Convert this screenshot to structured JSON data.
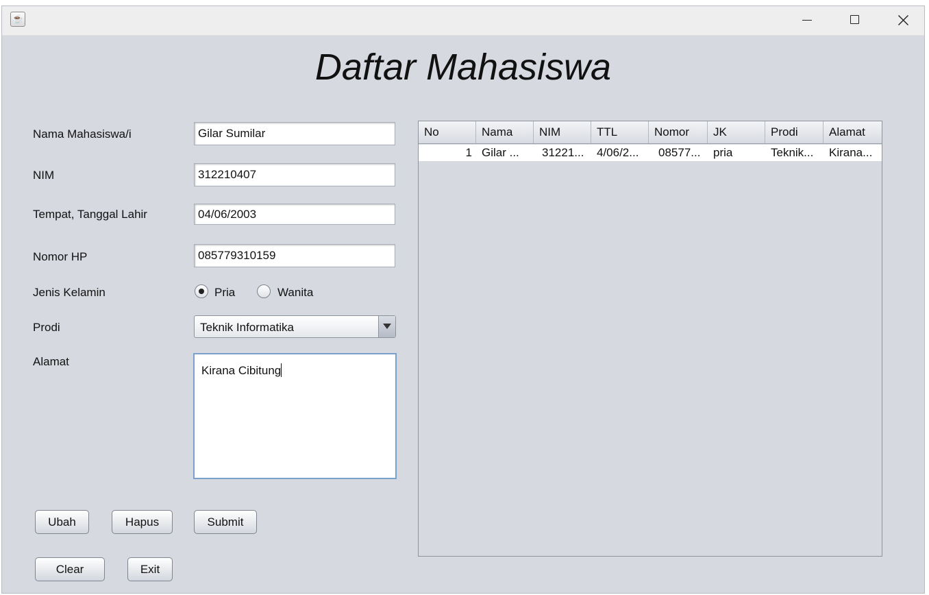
{
  "window": {
    "title": ""
  },
  "form": {
    "heading": "Daftar Mahasiswa",
    "labels": {
      "nama": "Nama Mahasiswa/i",
      "nim": "NIM",
      "ttl": "Tempat, Tanggal Lahir",
      "nomor": "Nomor HP",
      "jk": "Jenis Kelamin",
      "prodi": "Prodi",
      "alamat": "Alamat"
    },
    "values": {
      "nama": "Gilar Sumilar",
      "nim": "312210407",
      "ttl": "04/06/2003",
      "nomor": "085779310159",
      "prodi": "Teknik Informatika",
      "alamat": "Kirana Cibitung"
    },
    "gender_options": [
      "Pria",
      "Wanita"
    ],
    "gender_selected": "Pria",
    "buttons": {
      "ubah": "Ubah",
      "hapus": "Hapus",
      "submit": "Submit",
      "clear": "Clear",
      "exit": "Exit"
    }
  },
  "table": {
    "columns": [
      "No",
      "Nama",
      "NIM",
      "TTL",
      "Nomor",
      "JK",
      "Prodi",
      "Alamat"
    ],
    "rows": [
      [
        "1",
        "Gilar ...",
        "31221...",
        "4/06/2...",
        "08577...",
        "pria",
        "Teknik...",
        "Kirana..."
      ]
    ]
  }
}
